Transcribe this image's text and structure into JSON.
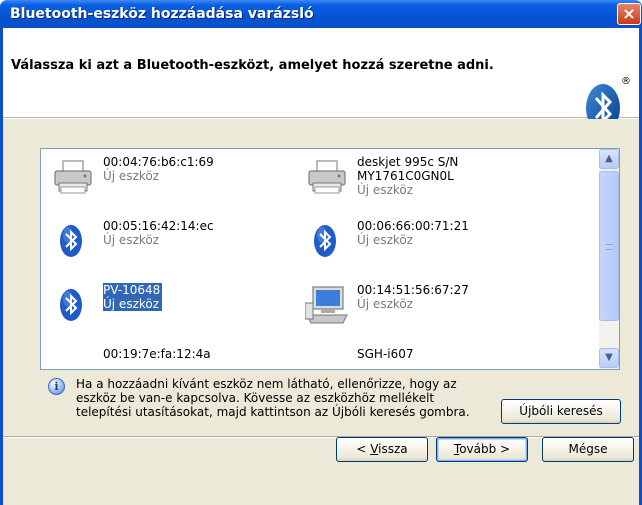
{
  "window": {
    "title": "Bluetooth-eszköz hozzáadása varázsló",
    "close_label": "×"
  },
  "header": {
    "heading": "Válassza ki azt a Bluetooth-eszközt, amelyet hozzá szeretne adni.",
    "logo_mark": "®"
  },
  "devices": [
    {
      "name": "00:04:76:b6:c1:69",
      "status": "Új eszköz",
      "icon": "printer-icon",
      "selected": false
    },
    {
      "name": "deskjet 995c S/N\nMY1761C0GN0L",
      "status": "Új eszköz",
      "icon": "printer-icon",
      "selected": false
    },
    {
      "name": "00:05:16:42:14:ec",
      "status": "Új eszköz",
      "icon": "bluetooth-icon",
      "selected": false
    },
    {
      "name": "00:06:66:00:71:21",
      "status": "Új eszköz",
      "icon": "bluetooth-icon",
      "selected": false
    },
    {
      "name": "PV-10648",
      "status": "Új eszköz",
      "icon": "bluetooth-icon",
      "selected": true
    },
    {
      "name": "00:14:51:56:67:27",
      "status": "Új eszköz",
      "icon": "computer-icon",
      "selected": false
    },
    {
      "name": "00:19:7e:fa:12:4a",
      "status": "",
      "icon": "laptop-icon",
      "selected": false
    },
    {
      "name": "SGH-i607",
      "status": "",
      "icon": "phone-icon",
      "selected": false
    }
  ],
  "scroll": {
    "up": "▲",
    "down": "▼"
  },
  "info": {
    "icon_glyph": "i",
    "text": "Ha a hozzáadni kívánt eszköz nem látható, ellenőrizze, hogy az eszköz be van-e kapcsolva. Kövesse az eszközhöz mellékelt telepítési utasításokat, majd kattintson az Újbóli keresés gombra."
  },
  "buttons": {
    "rescan": {
      "pre": "Ú",
      "accel": "j",
      "post": "bóli keresés"
    },
    "back": {
      "pre": "< ",
      "accel": "V",
      "post": "issza"
    },
    "next": {
      "pre": "",
      "accel": "T",
      "post": "ovább >"
    },
    "cancel": {
      "label": "Mégse"
    }
  },
  "colors": {
    "title_bar": "#0654d4",
    "selection": "#3168b5",
    "dialog_bg": "#ece9d8"
  }
}
